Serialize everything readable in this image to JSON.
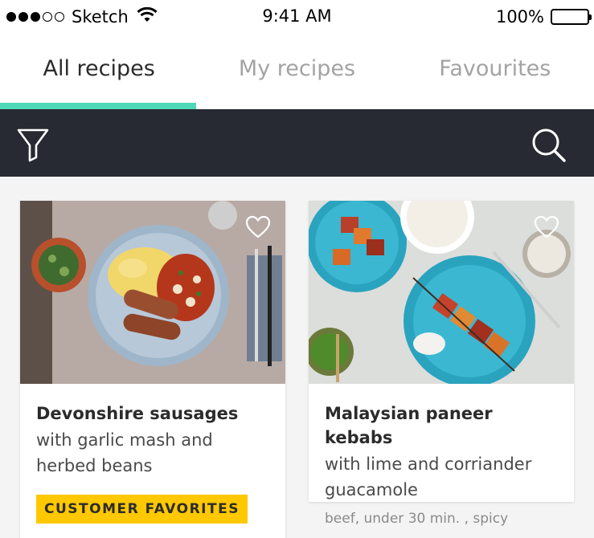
{
  "colors": {
    "accent": "#4fd8b6",
    "toolbar_bg": "#272a33",
    "badge_bg": "#ffc800",
    "tab_inactive": "#a3a3a3",
    "background": "#f4f4f4"
  },
  "status_bar": {
    "carrier": "Sketch",
    "time": "9:41 AM",
    "battery": "100%",
    "signal_bars_filled": 3,
    "signal_bars_total": 5
  },
  "tabs": [
    {
      "label": "All recipes",
      "active": true
    },
    {
      "label": "My recipes",
      "active": false
    },
    {
      "label": "Favourites",
      "active": false
    }
  ],
  "toolbar": {
    "filter_icon": "filter-icon",
    "search_icon": "search-icon"
  },
  "recipes": [
    {
      "title": "Devonshire sausages",
      "subtitle": "with garlic mash and herbed beans",
      "badge": "CUSTOMER FAVORITES",
      "favourited": false
    },
    {
      "title": "Malaysian paneer kebabs",
      "subtitle": "with lime and corriander guacamole",
      "tags": "beef, under 30 min. , spicy",
      "favourited": false
    }
  ]
}
